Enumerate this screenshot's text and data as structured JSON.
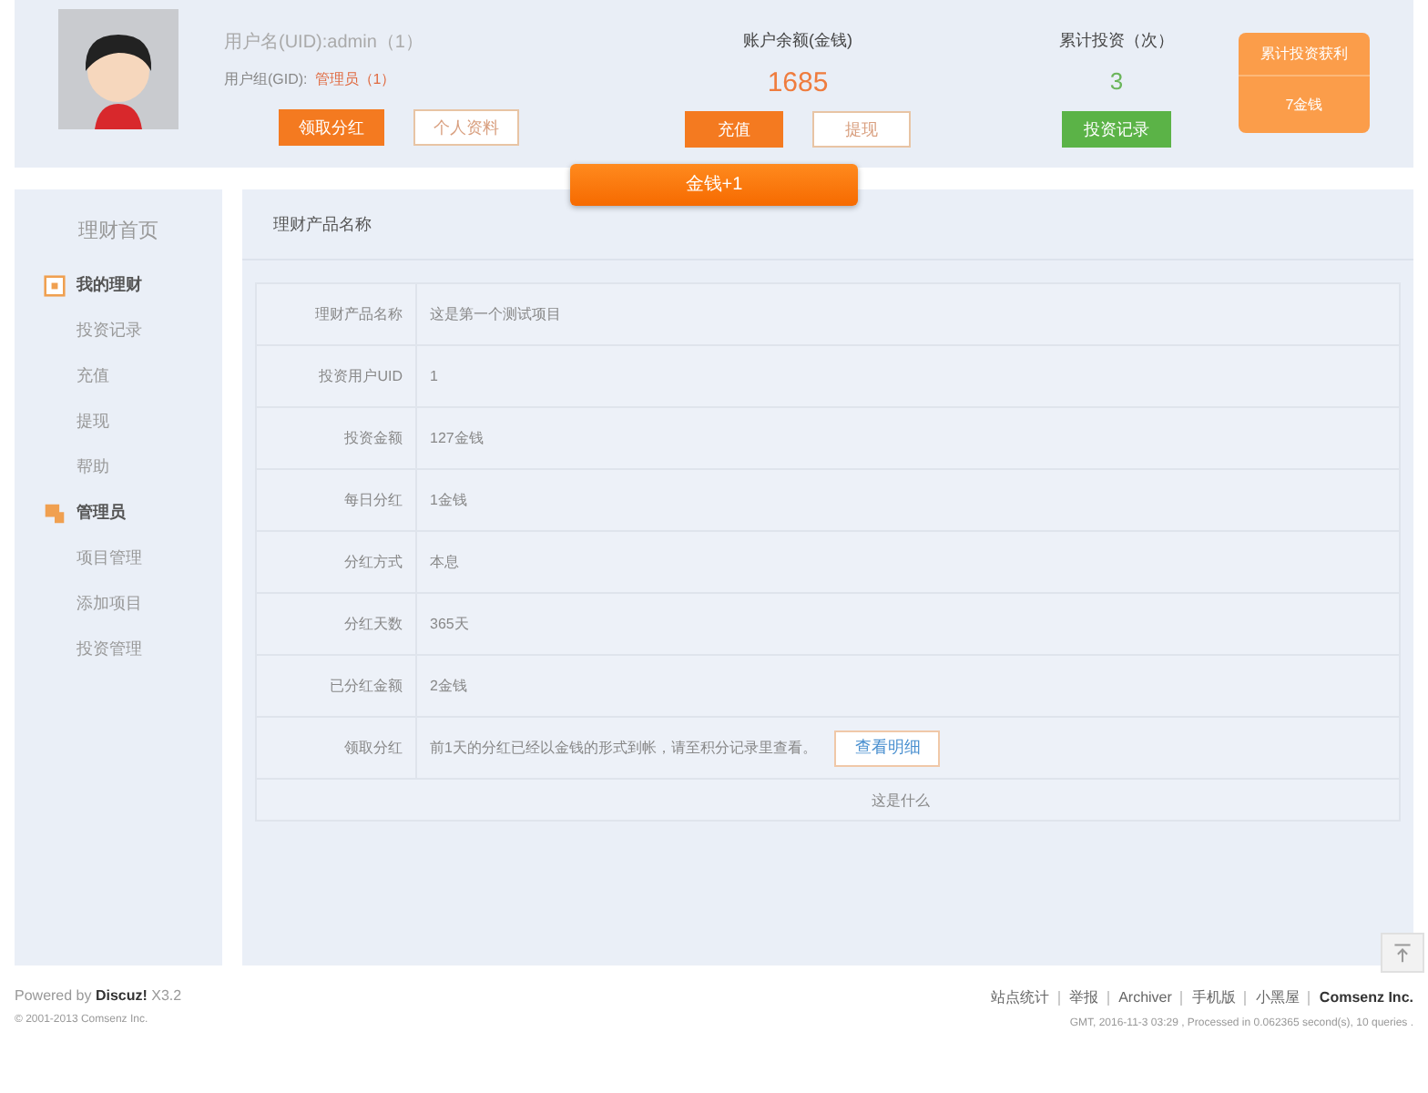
{
  "header": {
    "user_line": "用户名(UID):admin（1）",
    "group_label": "用户组(GID):",
    "group_value": "管理员（1）",
    "user_buttons": [
      {
        "label": "领取分红",
        "kind": "filled"
      },
      {
        "label": "个人资料",
        "kind": "outline"
      }
    ],
    "balance": {
      "label": "账户余额(金钱)",
      "value": "1685",
      "buttons": [
        {
          "label": "充值",
          "kind": "filled"
        },
        {
          "label": "提现",
          "kind": "outline"
        }
      ]
    },
    "investments": {
      "label": "累计投资（次）",
      "value": "3",
      "buttons": [
        {
          "label": "投资记录",
          "kind": "green"
        }
      ]
    },
    "profit_card": {
      "title": "累计投资获利",
      "value": "7金钱"
    }
  },
  "toast": "金钱+1",
  "sidebar": {
    "home": "理财首页",
    "groups": [
      {
        "label": "我的理财",
        "items": [
          "投资记录",
          "充值",
          "提现",
          "帮助"
        ]
      },
      {
        "label": "管理员",
        "items": [
          "项目管理",
          "添加项目",
          "投资管理"
        ]
      }
    ]
  },
  "main": {
    "title": "理财产品名称",
    "rows": [
      {
        "label": "理财产品名称",
        "value": "这是第一个测试项目"
      },
      {
        "label": "投资用户UID",
        "value": "1"
      },
      {
        "label": "投资金额",
        "value": "127金钱"
      },
      {
        "label": "每日分红",
        "value": "1金钱"
      },
      {
        "label": "分红方式",
        "value": "本息"
      },
      {
        "label": "分红天数",
        "value": "365天"
      },
      {
        "label": "已分红金额",
        "value": "2金钱"
      },
      {
        "label": "领取分红",
        "value": "前1天的分红已经以金钱的形式到帐，请至积分记录里查看。",
        "button": "查看明细"
      }
    ],
    "footer_link": "这是什么"
  },
  "footer": {
    "powered": "Powered by **Discuz!** X3.2",
    "copyright": "© 2001-2013 Comsenz Inc.",
    "links": [
      "站点统计",
      "举报",
      "Archiver",
      "手机版",
      "小黑屋"
    ],
    "company": "Comsenz Inc.",
    "stats": "GMT, 2016-11-3 03:29 , Processed in 0.062365 second(s), 10 queries ."
  }
}
